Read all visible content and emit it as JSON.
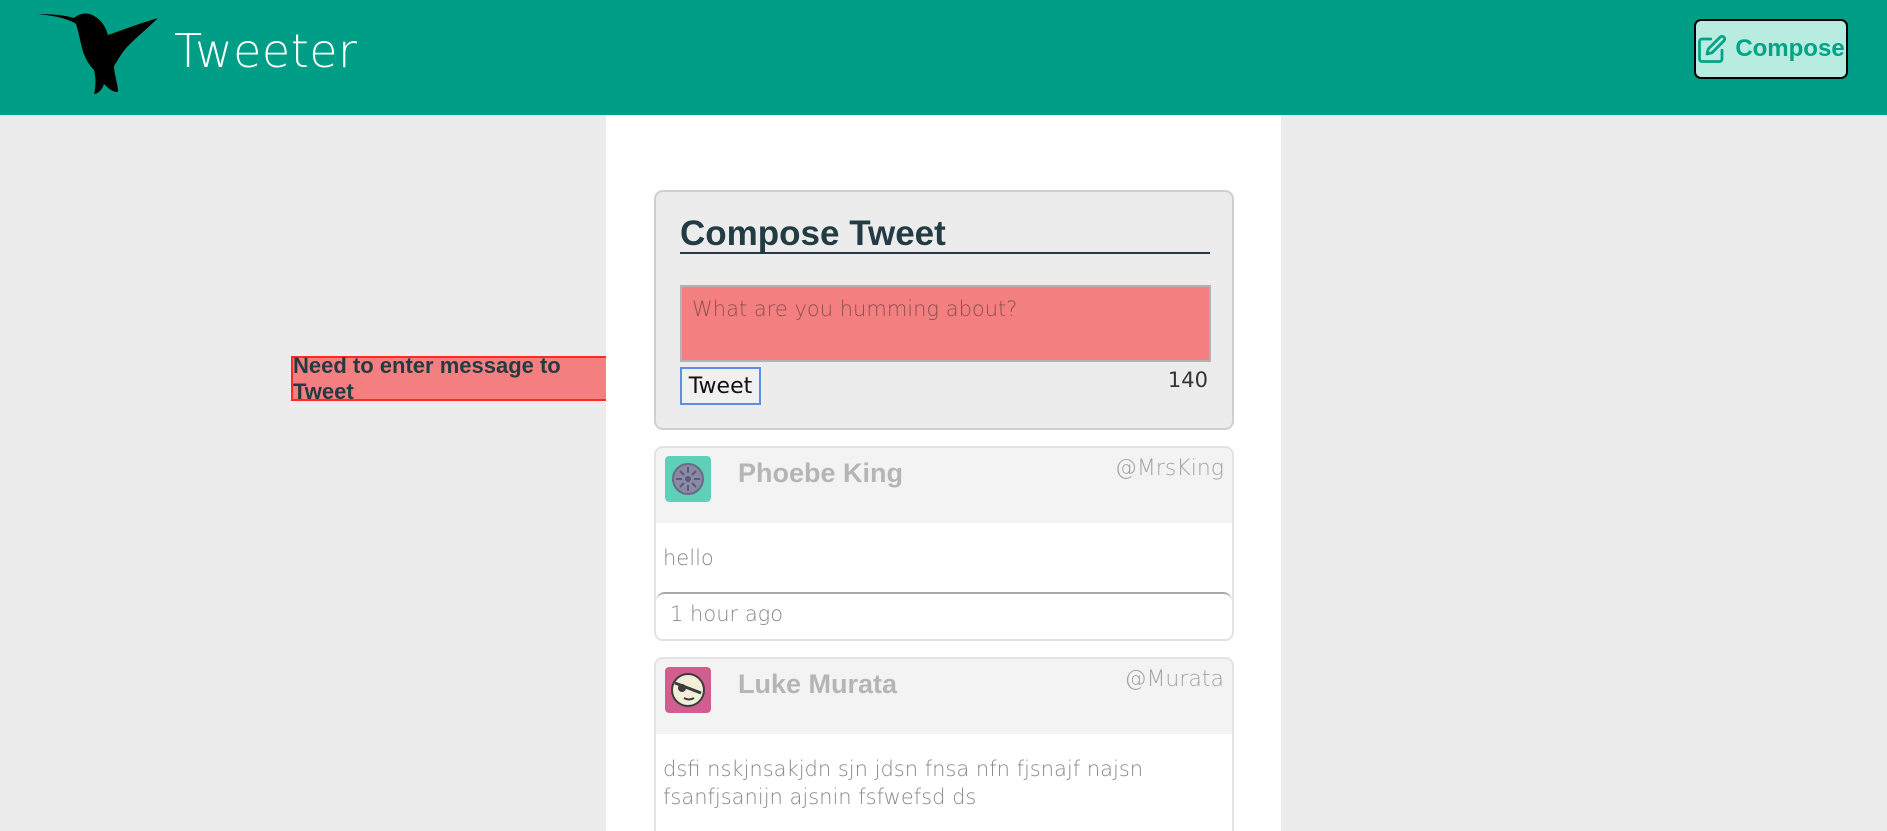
{
  "header": {
    "app_title": "Tweeter",
    "compose_label": "Compose",
    "logo_icon": "hummingbird-logo",
    "compose_icon": "edit-icon",
    "brand_color": "#009e86"
  },
  "compose": {
    "heading": "Compose Tweet",
    "placeholder": "What are you humming about?",
    "value": "",
    "submit_label": "Tweet",
    "counter": "140"
  },
  "error": {
    "message": "Need to enter message to Tweet",
    "color": "#f47f80"
  },
  "tweets": [
    {
      "name": "Phoebe King",
      "handle": "@MrsKing",
      "text": "hello",
      "time": "1 hour ago",
      "avatar_color": "#5ecfb8"
    },
    {
      "name": "Luke Murata",
      "handle": "@Murata",
      "text": "dsfi nskjnsakjdn sjn jdsn fnsa nfn fjsnajf najsn fsanfjsanijn ajsnin fsfwefsd ds",
      "time": "",
      "avatar_color": "#d25e8f"
    }
  ]
}
